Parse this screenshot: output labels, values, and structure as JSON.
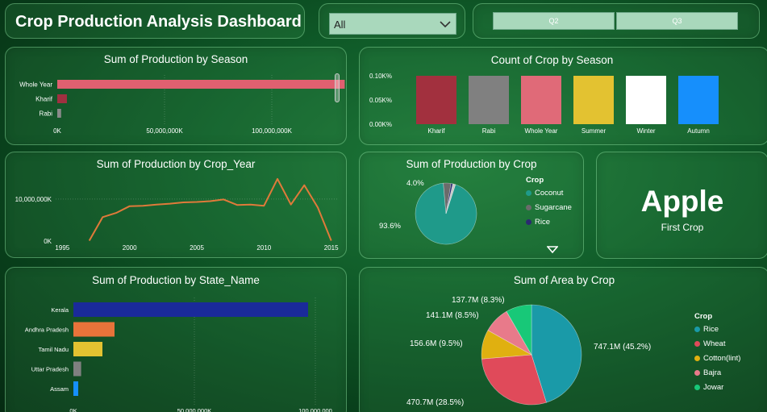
{
  "dashboard_title": "Crop Production Analysis Dashboard",
  "slicer": {
    "selected": "All"
  },
  "quarter_buttons": [
    "Q2",
    "Q3"
  ],
  "kpi": {
    "value": "Apple",
    "label": "First Crop"
  },
  "icons": {
    "dropdown": "chevron-down-icon",
    "scroll": "caret-down-icon"
  },
  "chart_data": [
    {
      "id": "season-production",
      "type": "bar",
      "orientation": "horizontal",
      "title": "Sum of Production by Season",
      "categories": [
        "Whole Year",
        "Kharif",
        "Rabi"
      ],
      "values": [
        134000000000,
        4500000000,
        1800000000
      ],
      "xlim": [
        0,
        150000000000
      ],
      "tick_values": [
        0,
        50000000000,
        100000000000
      ],
      "tick_labels": [
        "0K",
        "50,000,000K",
        "100,000,000K"
      ],
      "colors": [
        "#e06070",
        "#a03040",
        "#8a8a8a"
      ],
      "grid": true
    },
    {
      "id": "season-count",
      "type": "bar",
      "title": "Count of Crop by Season",
      "categories": [
        "Kharif",
        "Rabi",
        "Whole Year",
        "Summer",
        "Winter",
        "Autumn"
      ],
      "values": [
        0.1,
        0.1,
        0.1,
        0.1,
        0.1,
        0.1
      ],
      "ylim": [
        0,
        0.1
      ],
      "tick_values": [
        0,
        0.05,
        0.1
      ],
      "tick_labels": [
        "0.00K%",
        "0.05K%",
        "0.10K%"
      ],
      "colors": [
        "#a2303e",
        "#808080",
        "#e06a78",
        "#e3c231",
        "#ffffff",
        "#168ffc"
      ],
      "grid": false
    },
    {
      "id": "year-production",
      "type": "line",
      "title": "Sum of Production by Crop_Year",
      "x": [
        1997,
        1998,
        1999,
        2000,
        2001,
        2002,
        2003,
        2004,
        2005,
        2006,
        2007,
        2008,
        2009,
        2010,
        2011,
        2012,
        2013,
        2014,
        2015
      ],
      "y": [
        100000,
        5700000,
        6700000,
        8300000,
        8400000,
        8700000,
        8900000,
        9200000,
        9300000,
        9500000,
        9900000,
        8600000,
        8700000,
        8400000,
        14800000,
        8700000,
        13300000,
        8000000,
        100000
      ],
      "xlim": [
        1994.5,
        2015.5
      ],
      "ylim": [
        0,
        16500000
      ],
      "x_ticks": [
        1995,
        2000,
        2005,
        2010,
        2015
      ],
      "y_tick_values": [
        0,
        10000000
      ],
      "y_tick_labels": [
        "0K",
        "10,000,000K"
      ],
      "color": "#e07a3a",
      "grid": true
    },
    {
      "id": "crop-production",
      "type": "pie",
      "title": "Sum of Production by Crop",
      "legend_title": "Crop",
      "slices": [
        {
          "label": "Coconut",
          "value": 93.6,
          "color": "#1f9a8a"
        },
        {
          "label": "Sugarcane",
          "value": 4.0,
          "color": "#6b6b6b"
        },
        {
          "label": "Rice",
          "value": 1.0,
          "color": "#2a2a70"
        },
        {
          "label": "",
          "value": 1.4,
          "color": "#c8c8c8"
        }
      ],
      "data_labels": [
        "93.6%",
        "4.0%"
      ]
    },
    {
      "id": "state-production",
      "type": "bar",
      "orientation": "horizontal",
      "title": "Sum of Production by State_Name",
      "categories": [
        "Kerala",
        "Andhra Pradesh",
        "Tamil Nadu",
        "Uttar Pradesh",
        "Assam"
      ],
      "values": [
        97000000000,
        17000000000,
        12000000000,
        3200000000,
        2000000000
      ],
      "xlim": [
        0,
        100000000000
      ],
      "tick_values": [
        0,
        50000000000,
        100000000000
      ],
      "tick_labels": [
        "0K",
        "50,000,000K",
        "100,000,000"
      ],
      "colors": [
        "#1a2a9a",
        "#e8733a",
        "#e3c231",
        "#808080",
        "#168ffc"
      ],
      "grid": true
    },
    {
      "id": "area-crop",
      "type": "pie",
      "title": "Sum of Area by Crop",
      "legend_title": "Crop",
      "slices": [
        {
          "label": "Rice",
          "value": 747.1,
          "color": "#1a9aa8",
          "data_label": "747.1M (45.2%)"
        },
        {
          "label": "Wheat",
          "value": 470.7,
          "color": "#e04a5a",
          "data_label": "470.7M (28.5%)"
        },
        {
          "label": "Cotton(lint)",
          "value": 156.6,
          "color": "#e0b010",
          "data_label": "156.6M (9.5%)"
        },
        {
          "label": "Bajra",
          "value": 141.1,
          "color": "#e87a8a",
          "data_label": "141.1M (8.5%)"
        },
        {
          "label": "Jowar",
          "value": 137.7,
          "color": "#18c878",
          "data_label": "137.7M (8.3%)"
        }
      ]
    }
  ]
}
